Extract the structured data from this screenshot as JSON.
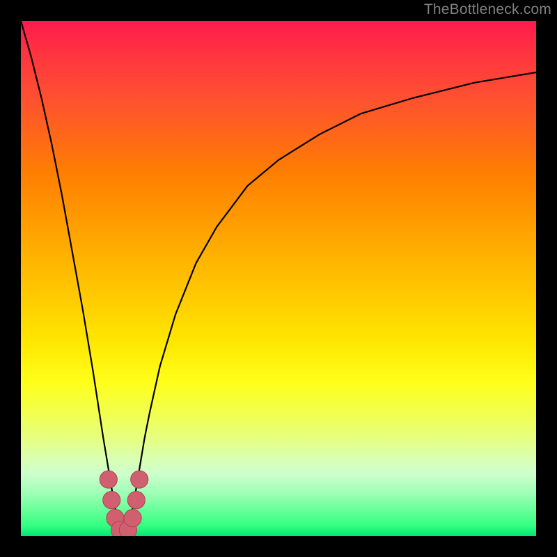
{
  "watermark": "TheBottleneck.com",
  "accent": {
    "marker_fill": "#d06070",
    "marker_stroke": "#b04050",
    "curve_stroke": "#000000"
  },
  "chart_data": {
    "type": "line",
    "title": "",
    "xlabel": "",
    "ylabel": "",
    "xlim": [
      0,
      100
    ],
    "ylim": [
      0,
      100
    ],
    "x_optimum_pct": 20,
    "series": [
      {
        "name": "bottleneck-curve",
        "x": [
          0,
          2,
          4,
          6,
          8,
          10,
          12,
          14,
          16,
          17,
          18,
          19,
          20,
          21,
          22,
          23,
          24,
          25,
          27,
          30,
          34,
          38,
          44,
          50,
          58,
          66,
          76,
          88,
          100
        ],
        "y": [
          100,
          93,
          85,
          76,
          66,
          55,
          44,
          32,
          19,
          13,
          7,
          2,
          0,
          2,
          7,
          13,
          19,
          24,
          33,
          43,
          53,
          60,
          68,
          73,
          78,
          82,
          85,
          88,
          90
        ]
      }
    ],
    "markers": {
      "name": "optimum-cluster",
      "points": [
        {
          "x": 17.0,
          "y": 11
        },
        {
          "x": 17.6,
          "y": 7
        },
        {
          "x": 18.3,
          "y": 3.5
        },
        {
          "x": 19.2,
          "y": 1.2
        },
        {
          "x": 20.8,
          "y": 1.2
        },
        {
          "x": 21.7,
          "y": 3.5
        },
        {
          "x": 22.4,
          "y": 7
        },
        {
          "x": 23.0,
          "y": 11
        }
      ],
      "radius_pct": 1.7
    }
  }
}
